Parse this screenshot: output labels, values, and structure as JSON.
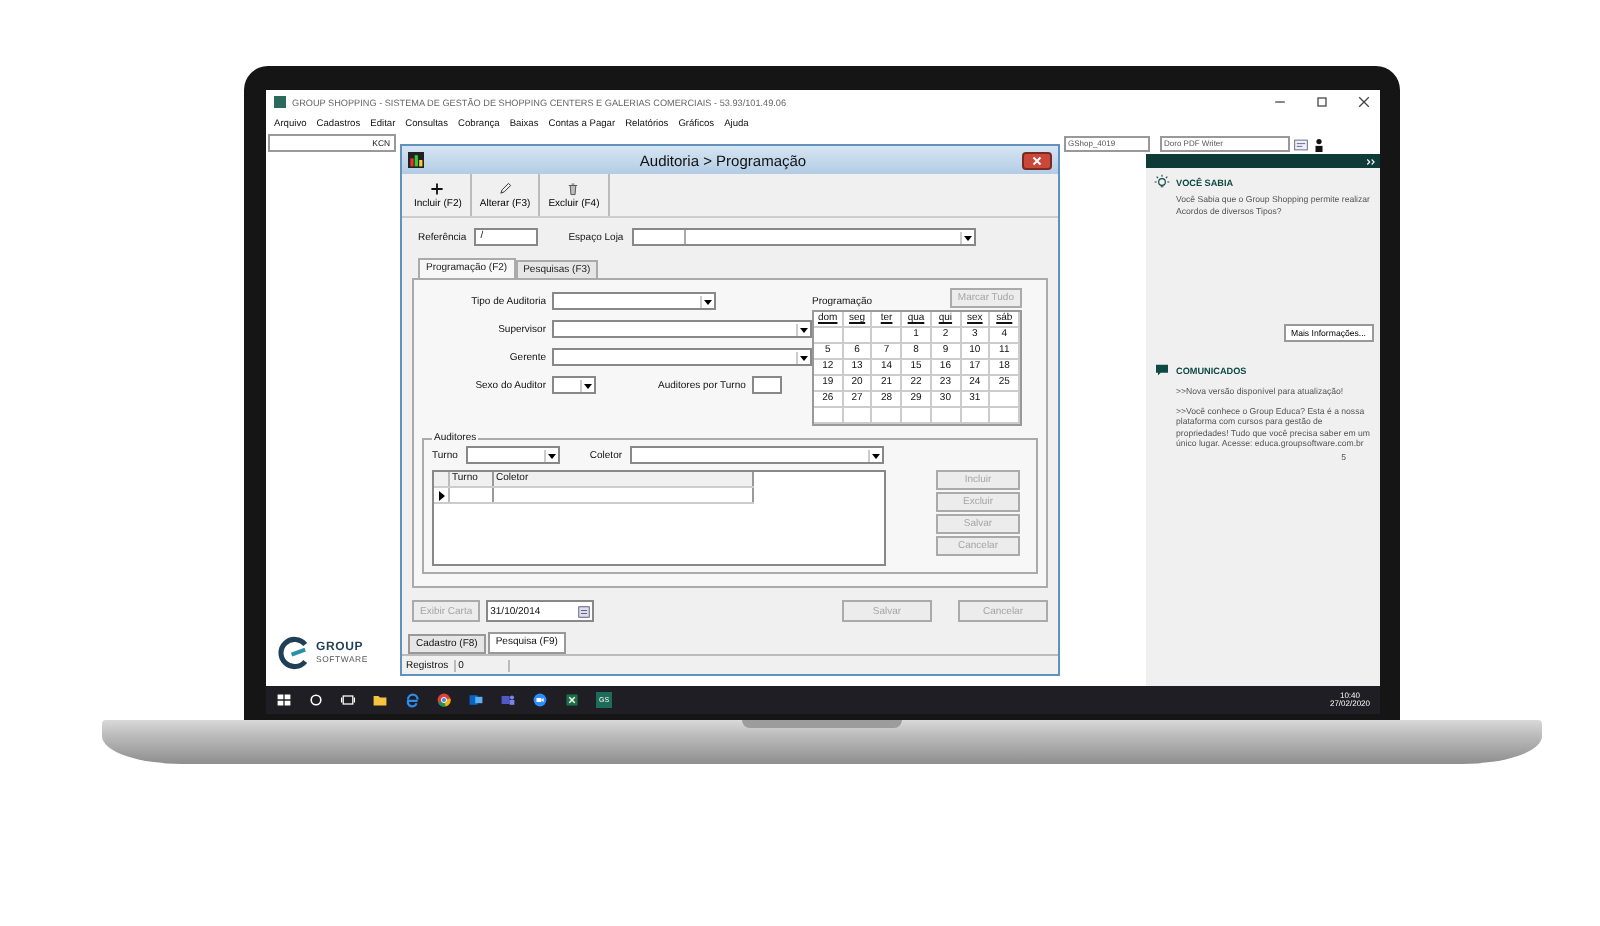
{
  "window": {
    "title": "GROUP SHOPPING - SISTEMA DE GESTÃO DE SHOPPING CENTERS E GALERIAS COMERCIAIS - 53.93/101.49.06"
  },
  "menu": [
    "Arquivo",
    "Cadastros",
    "Editar",
    "Consultas",
    "Cobrança",
    "Baixas",
    "Contas a Pagar",
    "Relatórios",
    "Gráficos",
    "Ajuda"
  ],
  "left_panel": {
    "field_value": "KCN",
    "logo": {
      "name": "GROUP",
      "tagline": "SOFTWARE"
    }
  },
  "dialog": {
    "title": "Auditoria > Programação",
    "toolbar": [
      {
        "label": "Incluir (F2)",
        "kind": "plus"
      },
      {
        "label": "Alterar (F3)",
        "kind": "pencil"
      },
      {
        "label": "Excluir (F4)",
        "kind": "trash"
      }
    ],
    "reference": {
      "label": "Referência",
      "value": "/"
    },
    "store_space": {
      "label": "Espaço Loja"
    },
    "tabs": [
      {
        "label": "Programação (F2)",
        "selected": true
      },
      {
        "label": "Pesquisas (F3)",
        "selected": false
      }
    ],
    "audit_type": {
      "label": "Tipo de Auditoria"
    },
    "supervisor": {
      "label": "Supervisor"
    },
    "manager": {
      "label": "Gerente"
    },
    "auditor_sex": {
      "label": "Sexo do Auditor"
    },
    "auditors_per_shift": {
      "label": "Auditores por Turno"
    },
    "calendar": {
      "title": "Programação",
      "button": {
        "label": "Marcar Tudo",
        "disabled": true
      },
      "weekdays": [
        "dom",
        "seg",
        "ter",
        "qua",
        "qui",
        "sex",
        "sáb"
      ],
      "weeks": [
        {
          "kind": "first",
          "days": [
            "1",
            "2",
            "3",
            "4"
          ]
        },
        {
          "kind": "week",
          "days": [
            "5",
            "6",
            "7",
            "8",
            "9",
            "10",
            "11"
          ]
        },
        {
          "kind": "week",
          "days": [
            "12",
            "13",
            "14",
            "15",
            "16",
            "17",
            "18"
          ]
        },
        {
          "kind": "week",
          "days": [
            "19",
            "20",
            "21",
            "22",
            "23",
            "24",
            "25"
          ]
        },
        {
          "kind": "week",
          "days": [
            "26",
            "27",
            "28",
            "29",
            "30",
            "31"
          ]
        }
      ]
    },
    "auditors": {
      "title": "Auditores",
      "shift_label": "Turno",
      "collector_label": "Coletor",
      "columns": [
        "Turno",
        "Coletor"
      ],
      "buttons": [
        {
          "label": "Incluir",
          "disabled": true
        },
        {
          "label": "Excluir",
          "disabled": true
        },
        {
          "label": "Salvar",
          "disabled": true
        },
        {
          "label": "Cancelar",
          "disabled": true
        }
      ]
    },
    "letter_button": {
      "label": "Exibir Carta",
      "disabled": true
    },
    "date": "31/10/2014",
    "footer_buttons": [
      {
        "label": "Salvar",
        "disabled": true
      },
      {
        "label": "Cancelar",
        "disabled": true
      }
    ],
    "bottom_tabs": [
      {
        "label": "Cadastro (F8)",
        "selected": false
      },
      {
        "label": "Pesquisa (F9)",
        "selected": true
      }
    ],
    "status": {
      "label": "Registros",
      "value": "0"
    }
  },
  "right_panel": {
    "fields": [
      "GShop_4019",
      "Doro PDF Writer"
    ],
    "tip": {
      "title": "VOCÊ SABIA",
      "text": "Você Sabia que o Group Shopping permite realizar Acordos de diversos Tipos?",
      "button": "Mais Informações..."
    },
    "news": {
      "title": "COMUNICADOS",
      "items": [
        ">>Nova versão disponível para atualização!",
        ">>Você conhece o Group Educa? Esta é a nossa plataforma com cursos para gestão de propriedades! Tudo que você precisa saber em um único lugar. Acesse: educa.groupsoftware.com.br"
      ],
      "counter": "5"
    }
  },
  "taskbar": {
    "apps": [
      {
        "kind": "folder"
      },
      {
        "kind": "browser"
      },
      {
        "kind": "chrome"
      },
      {
        "kind": "mail"
      },
      {
        "kind": "people"
      },
      {
        "kind": "video"
      },
      {
        "kind": "sheet"
      },
      {
        "kind": "app",
        "label": "GS"
      }
    ],
    "time": "10:40",
    "date": "27/02/2020"
  }
}
